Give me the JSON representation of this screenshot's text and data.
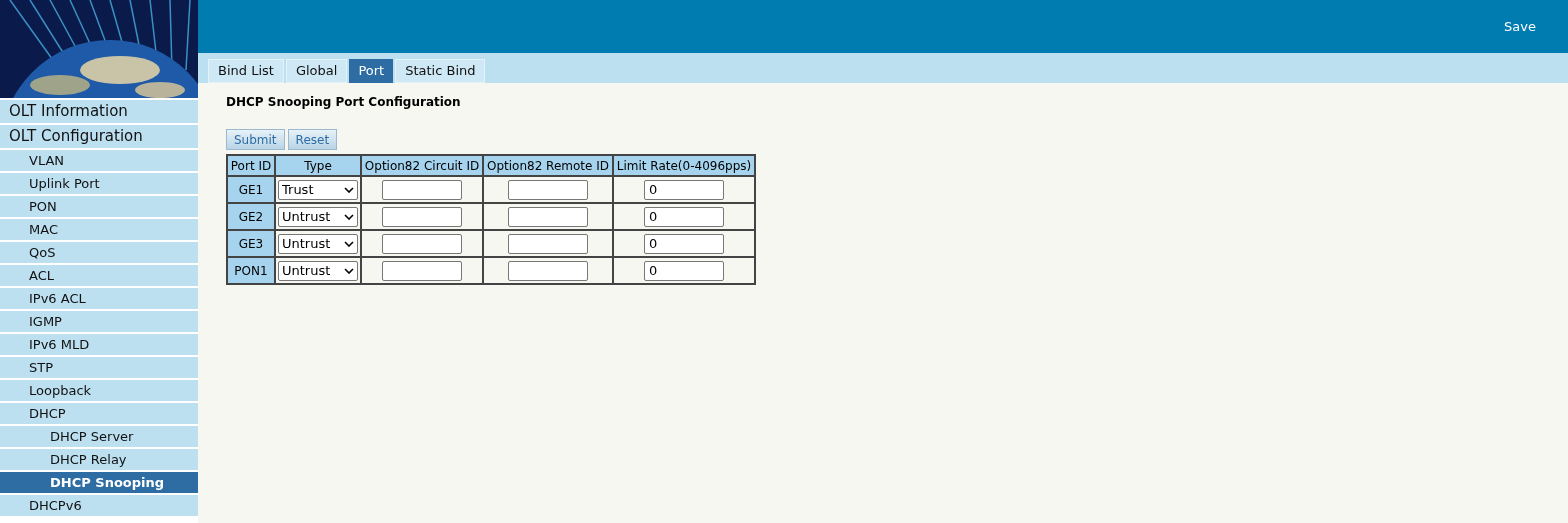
{
  "header": {
    "save": "Save"
  },
  "sidebar": {
    "items": [
      {
        "label": "OLT Information",
        "selected": false
      },
      {
        "label": "OLT Configuration",
        "selected": false,
        "children": [
          {
            "label": "VLAN",
            "selected": false
          },
          {
            "label": "Uplink Port",
            "selected": false
          },
          {
            "label": "PON",
            "selected": false
          },
          {
            "label": "MAC",
            "selected": false
          },
          {
            "label": "QoS",
            "selected": false
          },
          {
            "label": "ACL",
            "selected": false
          },
          {
            "label": "IPv6 ACL",
            "selected": false
          },
          {
            "label": "IGMP",
            "selected": false
          },
          {
            "label": "IPv6 MLD",
            "selected": false
          },
          {
            "label": "STP",
            "selected": false
          },
          {
            "label": "Loopback",
            "selected": false
          },
          {
            "label": "DHCP",
            "selected": false,
            "children": [
              {
                "label": "DHCP Server",
                "selected": false
              },
              {
                "label": "DHCP Relay",
                "selected": false
              },
              {
                "label": "DHCP Snooping",
                "selected": true
              }
            ]
          },
          {
            "label": "DHCPv6",
            "selected": false
          }
        ]
      }
    ]
  },
  "tabs": [
    {
      "label": "Bind List",
      "selected": false
    },
    {
      "label": "Global",
      "selected": false
    },
    {
      "label": "Port",
      "selected": true
    },
    {
      "label": "Static Bind",
      "selected": false
    }
  ],
  "section_title": "DHCP Snooping Port Configuration",
  "buttons": [
    "Submit",
    "Reset"
  ],
  "table": {
    "columns": [
      "Port ID",
      "Type",
      "Option82 Circuit ID",
      "Option82 Remote ID",
      "Limit Rate(0-4096pps)"
    ],
    "rows": [
      {
        "port": "GE1",
        "type": "Trust",
        "limit_rate": "0"
      },
      {
        "port": "GE2",
        "type": "Untrust",
        "limit_rate": "0"
      },
      {
        "port": "GE3",
        "type": "Untrust",
        "limit_rate": "0"
      },
      {
        "port": "PON1",
        "type": "Untrust",
        "limit_rate": "0"
      }
    ]
  }
}
